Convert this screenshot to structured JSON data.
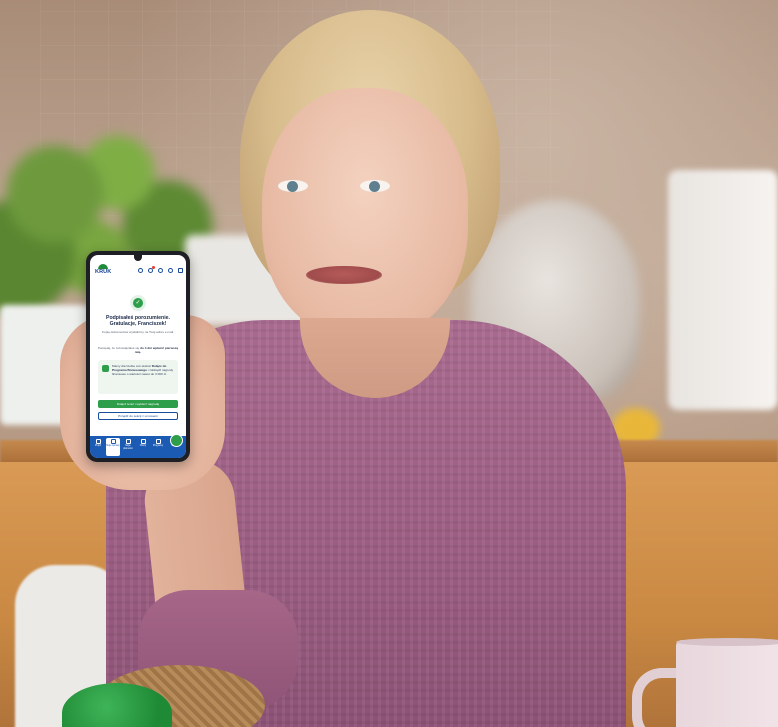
{
  "phone_app": {
    "logo_text": "KRUK",
    "check_symbol": "✓",
    "title": "Podpisałeś porozumienie. Gratulacje, Franciszek!",
    "subtitle": "Kopię dokumentów wysłaliśmy na Twój adres e-mail.",
    "reminder_prefix": "Pamiętaj, że zobowiązałeś się",
    "reminder_bold": "do 4 dni wpłacić pierwszą ratę.",
    "promo_prefix": "Mamy dla Ciebie coś ekstra!",
    "promo_bold": "Dołącz do Programu Bonusowego",
    "promo_suffix": "i zdobądź nagrody finansowe o wartości nawet do 3 000 zł.",
    "primary_button": "Dołącz teraz i wybierz nagrodę",
    "secondary_button": "Przejdź do sekcji z umowami",
    "nav": [
      {
        "label": "Pulpit",
        "icon": "home-icon"
      },
      {
        "label": "Moje sprawy",
        "icon": "folder-icon"
      },
      {
        "label": "Moje płatności",
        "icon": "wallet-icon"
      },
      {
        "label": "Oferty",
        "icon": "tag-icon"
      },
      {
        "label": "Programy",
        "icon": "gift-icon"
      },
      {
        "label": "Więcej",
        "icon": "menu-icon"
      }
    ],
    "colors": {
      "brand_blue": "#1c5bb3",
      "brand_green": "#2e9e4a"
    }
  }
}
